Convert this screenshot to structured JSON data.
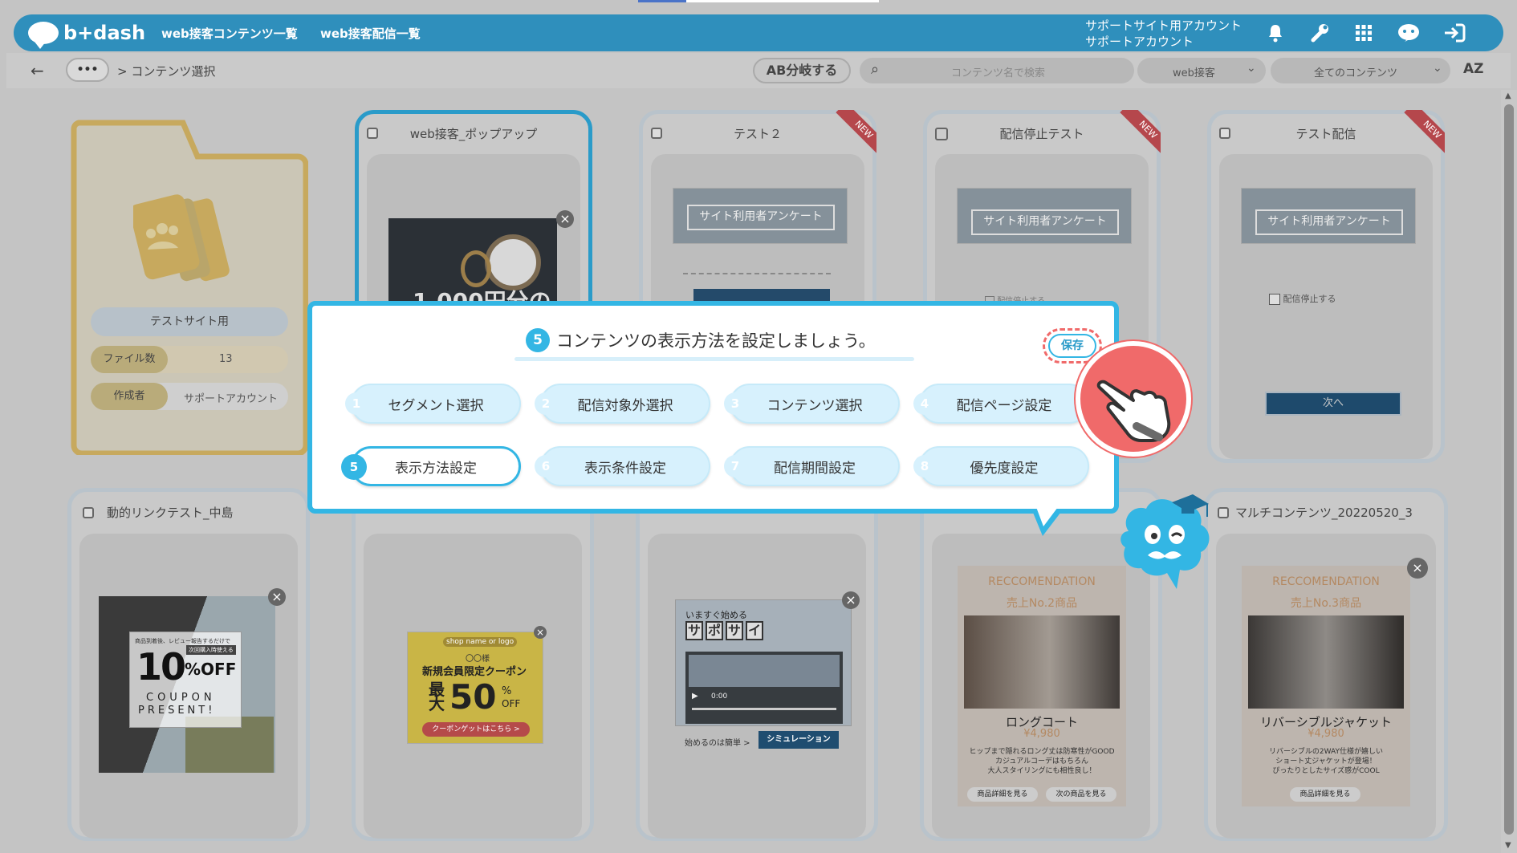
{
  "header": {
    "logo_text": "b+dash",
    "nav": [
      "web接客コンテンツ一覧",
      "web接客配信一覧"
    ],
    "account_line1": "サポートサイト用アカウント",
    "account_line2": "サポートアカウント",
    "icons": [
      "bell-icon",
      "wrench-icon",
      "grid-icon",
      "support-icon",
      "logout-icon"
    ]
  },
  "subbar": {
    "breadcrumb_more": "•••",
    "breadcrumb_current": "> コンテンツ選択",
    "ab_button": "AB分岐する",
    "search_placeholder": "コンテンツ名で検索",
    "type_select": "web接客",
    "filter_select": "全てのコンテンツ",
    "sort_icon": "AZ"
  },
  "folder": {
    "name": "テストサイト用",
    "file_count_label": "ファイル数",
    "file_count": "13",
    "author_label": "作成者",
    "author": "サポートアカウント"
  },
  "cards_row1": [
    {
      "title": "web接客_ポップアップ",
      "banner_text": "1,000円分の"
    },
    {
      "title": "テスト２",
      "badge": "NEW",
      "banner_label": "サイト利用者アンケート"
    },
    {
      "title": "配信停止テスト",
      "badge": "NEW",
      "banner_label": "サイト利用者アンケート",
      "checkbox_label": "配信停止する"
    },
    {
      "title": "テスト配信",
      "badge": "NEW",
      "banner_label": "サイト利用者アンケート",
      "checkbox_label": "配信停止する",
      "next_button": "次へ"
    }
  ],
  "cards_row2": [
    {
      "title": "動的リンクテスト_中島",
      "coupon_small": "商品到着後、レビュー報告するだけで",
      "coupon_tag": "次回購入時使える",
      "coupon_big": "10",
      "coupon_off": "%OFF",
      "coupon_word1": "COUPON",
      "coupon_word2": "PRESENT!"
    },
    {
      "title": "",
      "shop_name": "shop name or logo",
      "member_line": "〇〇様",
      "member_coupon": "新規会員限定クーポン",
      "max_label": "最大",
      "max_value": "50",
      "max_unit": "%",
      "max_off": "OFF",
      "coupon_button": "クーポンゲットはこちら >"
    },
    {
      "title": "",
      "start_text": "いますぐ始める",
      "chars": [
        "サ",
        "ポ",
        "サ",
        "イ"
      ],
      "video_time": "0:00",
      "easy_text": "始めるのは簡単 >",
      "sim_button": "シミュレーション"
    },
    {
      "title": "",
      "rec_title": "RECCOMENDATION",
      "rec_sub": "売上No.2商品",
      "product": "ロングコート",
      "price": "¥4,980",
      "desc1": "ヒップまで隠れるロング丈は防寒性がGOOD",
      "desc2": "カジュアルコーデはもちろん",
      "desc3": "大人スタイリングにも相性良し！",
      "btn1": "商品詳細を見る",
      "btn2": "次の商品を見る"
    },
    {
      "title": "マルチコンテンツ_20220520_3",
      "rec_title": "RECCOMENDATION",
      "rec_sub": "売上No.3商品",
      "product": "リバーシブルジャケット",
      "price": "¥4,980",
      "desc1": "リバーシブルの2WAY仕様が嬉しい",
      "desc2": "ショート丈ジャケットが登場！",
      "desc3": "ぴったりとしたサイズ感がCOOL",
      "btn1": "商品詳細を見る"
    }
  ],
  "modal": {
    "step_badge": "5",
    "heading": "コンテンツの表示方法を設定しましょう。",
    "save_button": "保存",
    "steps": [
      {
        "num": "1",
        "label": "セグメント選択"
      },
      {
        "num": "2",
        "label": "配信対象外選択"
      },
      {
        "num": "3",
        "label": "コンテンツ選択"
      },
      {
        "num": "4",
        "label": "配信ページ設定"
      },
      {
        "num": "5",
        "label": "表示方法設定"
      },
      {
        "num": "6",
        "label": "表示条件設定"
      },
      {
        "num": "7",
        "label": "配信期間設定"
      },
      {
        "num": "8",
        "label": "優先度設定"
      }
    ],
    "active_step": 5
  },
  "colors": {
    "brand": "#2f8fbc",
    "accent": "#33b6e4",
    "highlight": "#f06a6a"
  }
}
